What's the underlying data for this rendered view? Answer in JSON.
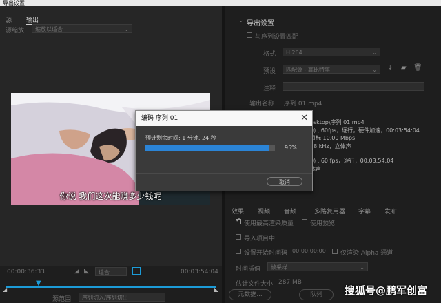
{
  "window": {
    "title": "导出设置"
  },
  "left": {
    "tabs": [
      "源",
      "输出"
    ],
    "source_scaling_label": "源缩放",
    "source_scaling_value": "缩放以适合",
    "subtitle": "你说  我们这次能赚多少钱呢",
    "timecode_start": "00:00:36:33",
    "timecode_end": "00:03:54:04",
    "fit_label": "适合",
    "source_range_label": "源范围",
    "source_range_value": "序列切入/序列切出"
  },
  "dialog": {
    "title": "编码 序列 01",
    "remaining_text": "预计剩余时间: 1 分钟, 24 秒",
    "progress_percent": 95,
    "progress_label": "95%",
    "cancel_label": "取消"
  },
  "right": {
    "section_title": "导出设置",
    "match_sequence": "与序列设置匹配",
    "format_label": "格式",
    "format_value": "H.264",
    "preset_label": "预设",
    "preset_value": "匹配源 - 高比特率",
    "comments_label": "注释",
    "output_name_label": "输出名称",
    "output_name_value": "序列 01.mp4",
    "partial_label": "频",
    "summary_lines": [
      "esktop\\序列 01.mp4",
      "0) , 60fps，逐行，硬件加速，00:03:54:04",
      "目标 10.00 Mbps",
      "48  kHz，立体声",
      "0) , 60 fps，逐行，00:03:54:04",
      "体声"
    ],
    "tabs": [
      "效果",
      "视频",
      "音频",
      "多路复用器",
      "字幕",
      "发布"
    ],
    "max_render_quality": "使用最高渲染质量",
    "use_preview": "使用预览",
    "import_project": "导入项目中",
    "set_start_timecode": "设置开始时间码",
    "start_timecode_value": "00:00:00:00",
    "render_alpha": "仅渲染 Alpha 通道",
    "time_interp_label": "时间插值",
    "time_interp_value": "帧采样",
    "file_size_label": "估计文件大小:",
    "file_size_value": "287 MB",
    "metadata_button": "元数据...",
    "queue_button": "队列"
  },
  "watermark": "搜狐号@鹏军创富",
  "colors": {
    "progress": "#2b84d6",
    "accent_timeline": "#1c9bd7"
  }
}
